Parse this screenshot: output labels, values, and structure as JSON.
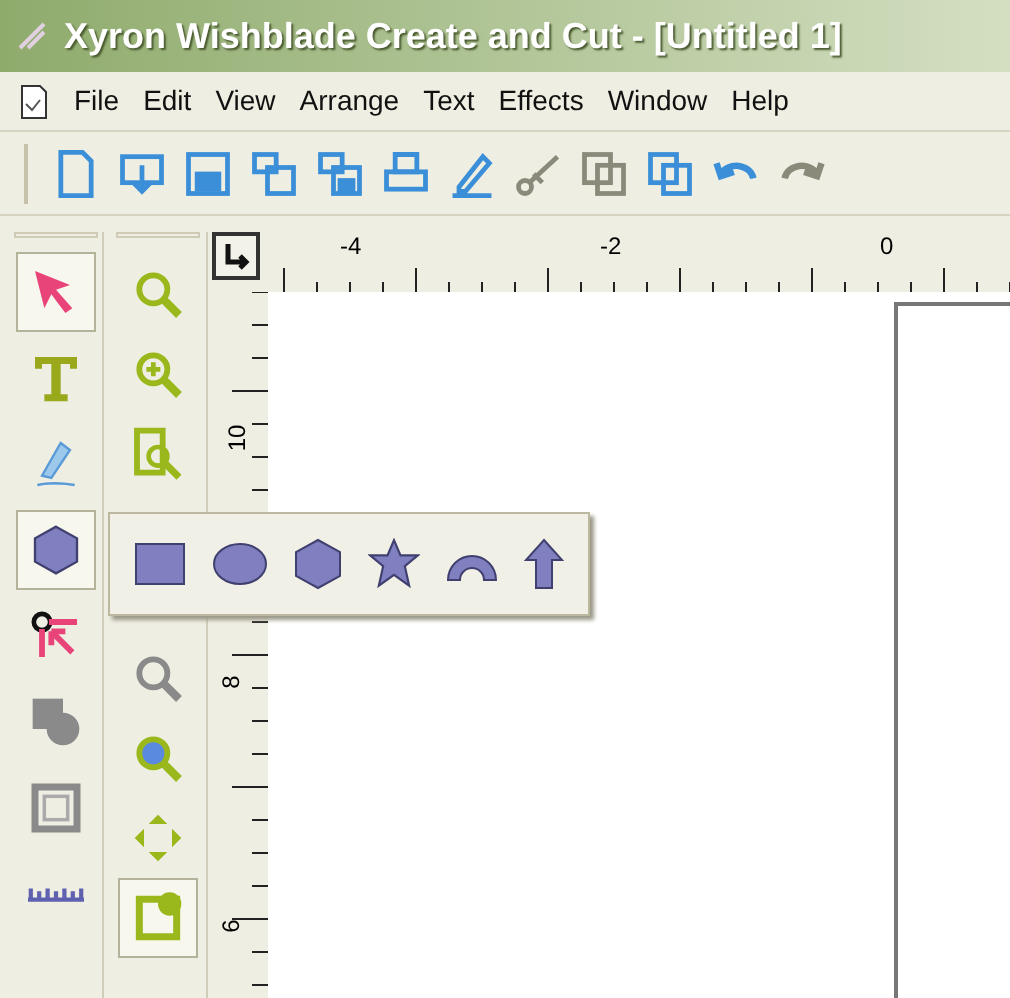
{
  "window": {
    "title": "Xyron Wishblade Create and Cut - [Untitled 1]"
  },
  "menu": [
    "File",
    "Edit",
    "View",
    "Arrange",
    "Text",
    "Effects",
    "Window",
    "Help"
  ],
  "toolbar": [
    {
      "kind": "new"
    },
    {
      "kind": "open"
    },
    {
      "kind": "save"
    },
    {
      "kind": "import"
    },
    {
      "kind": "export"
    },
    {
      "kind": "print"
    },
    {
      "kind": "pen"
    },
    {
      "kind": "cut"
    },
    {
      "kind": "copy"
    },
    {
      "kind": "paste"
    },
    {
      "kind": "undo"
    },
    {
      "kind": "redo"
    }
  ],
  "tools": [
    {
      "kind": "select",
      "selected": true
    },
    {
      "kind": "text",
      "selected": false
    },
    {
      "kind": "pen",
      "selected": false
    },
    {
      "kind": "shape",
      "selected": true
    },
    {
      "kind": "node",
      "selected": false
    },
    {
      "kind": "weld",
      "selected": false
    },
    {
      "kind": "frame",
      "selected": false
    },
    {
      "kind": "measure",
      "selected": false
    }
  ],
  "zoom_tools": [
    {
      "kind": "zoom-fit",
      "selected": false
    },
    {
      "kind": "zoom-in",
      "selected": false
    },
    {
      "kind": "zoom-page",
      "selected": false
    },
    {
      "kind": "zoom-gray",
      "selected": false
    },
    {
      "kind": "zoom-color",
      "selected": false
    },
    {
      "kind": "pan",
      "selected": false
    },
    {
      "kind": "page",
      "selected": true
    }
  ],
  "ruler": {
    "horizontal": [
      "-4",
      "-2",
      "0"
    ],
    "vertical": [
      "10",
      "8",
      "6"
    ]
  },
  "shape_flyout": [
    {
      "kind": "rectangle"
    },
    {
      "kind": "ellipse"
    },
    {
      "kind": "hexagon"
    },
    {
      "kind": "star"
    },
    {
      "kind": "arc"
    },
    {
      "kind": "arrow"
    }
  ]
}
